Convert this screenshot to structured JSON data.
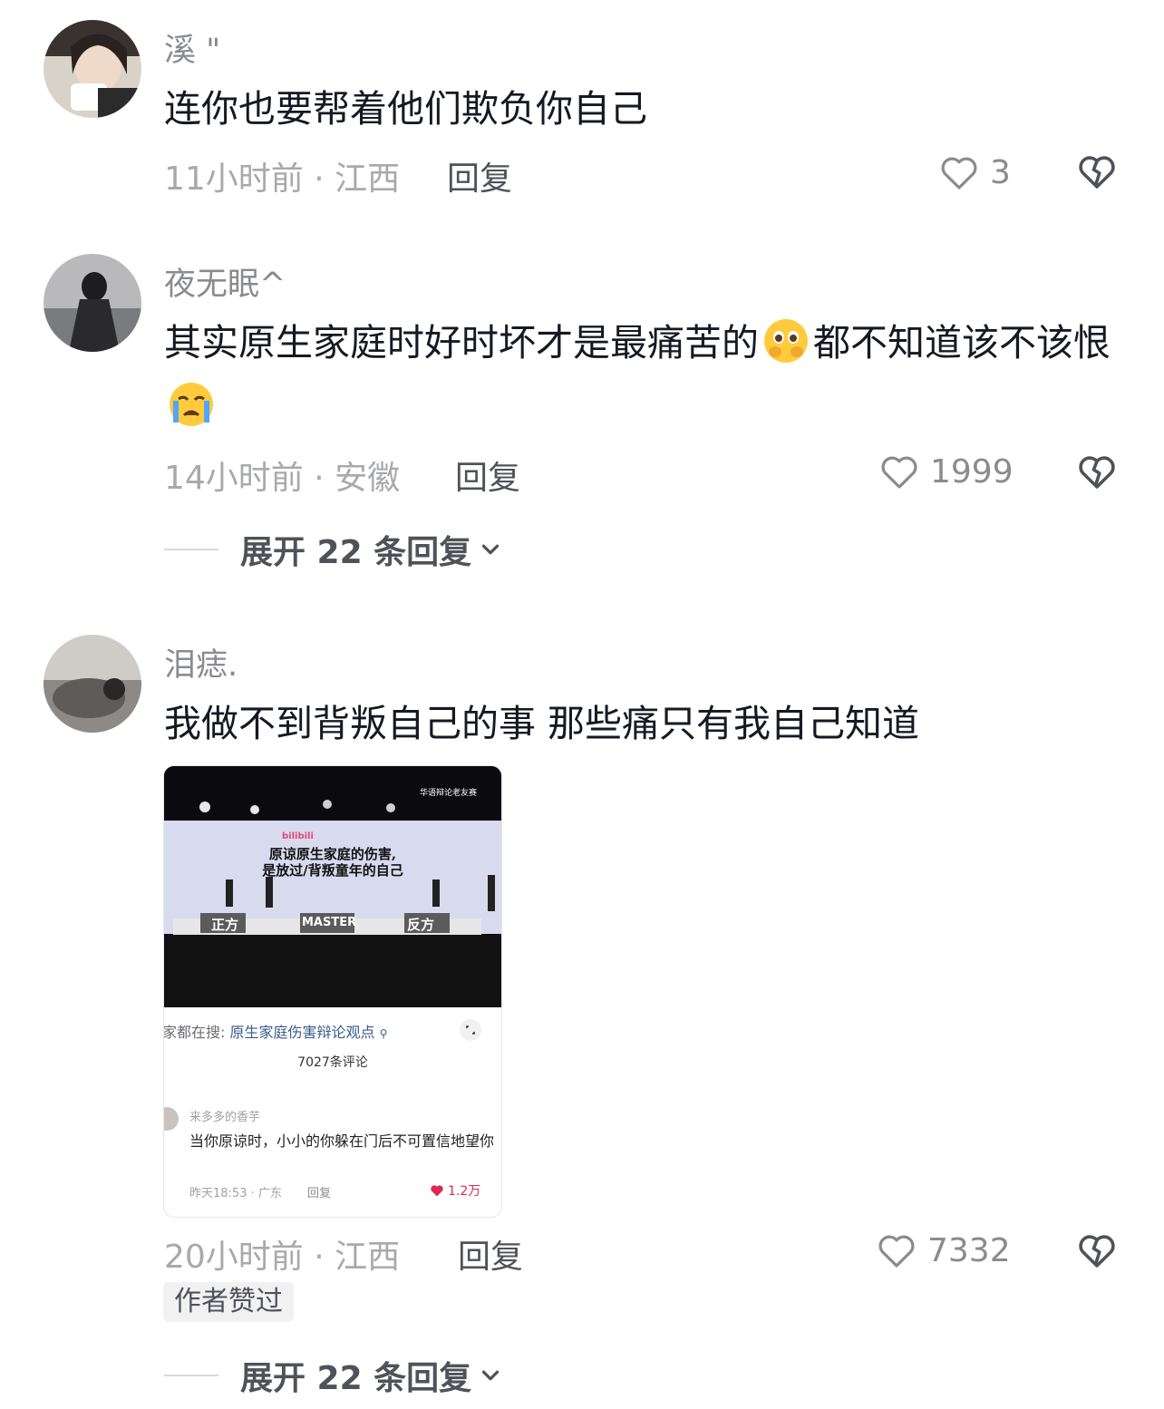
{
  "comments": [
    {
      "username": "溪 \"",
      "text": "连你也要帮着他们欺负你自己",
      "meta": "11小时前 · 江西",
      "reply_label": "回复",
      "likes": "3"
    },
    {
      "username": "夜无眠^",
      "text_part1": "其实原生家庭时好时坏才是最痛苦的",
      "text_part2": "都不知道该不该恨",
      "meta": "14小时前 · 安徽",
      "reply_label": "回复",
      "likes": "1999",
      "expand_label": "展开 22 条回复"
    },
    {
      "username": "泪痣.",
      "text": "我做不到背叛自己的事 那些痛只有我自己知道",
      "meta": "20小时前 · 江西",
      "reply_label": "回复",
      "likes": "7332",
      "badge": "作者赞过",
      "expand_label": "展开 22 条回复",
      "card": {
        "banner_title_line1": "原谅原生家庭的伤害,",
        "banner_title_line2": "是放过/背叛童年的自己",
        "brand": "bilibili",
        "top_caption": "华语辩论老友赛",
        "stage_left": "正方",
        "stage_right": "反方",
        "stage_center": "MASTER",
        "search_prefix": "家都在搜:",
        "search_keyword": "原生家庭伤害辩论观点",
        "comment_count": "7027条评论",
        "inner_user": "来多多的香芋",
        "inner_text": "当你原谅时，小小的你躲在门后不可置信地望你",
        "inner_meta": "昨天18:53 · 广东",
        "inner_reply": "回复",
        "inner_likes": "1.2万"
      }
    }
  ],
  "colors": {
    "text": "#161823",
    "secondary": "#8a8b91",
    "meta": "#a8a9ad",
    "like_red": "#e02850"
  }
}
